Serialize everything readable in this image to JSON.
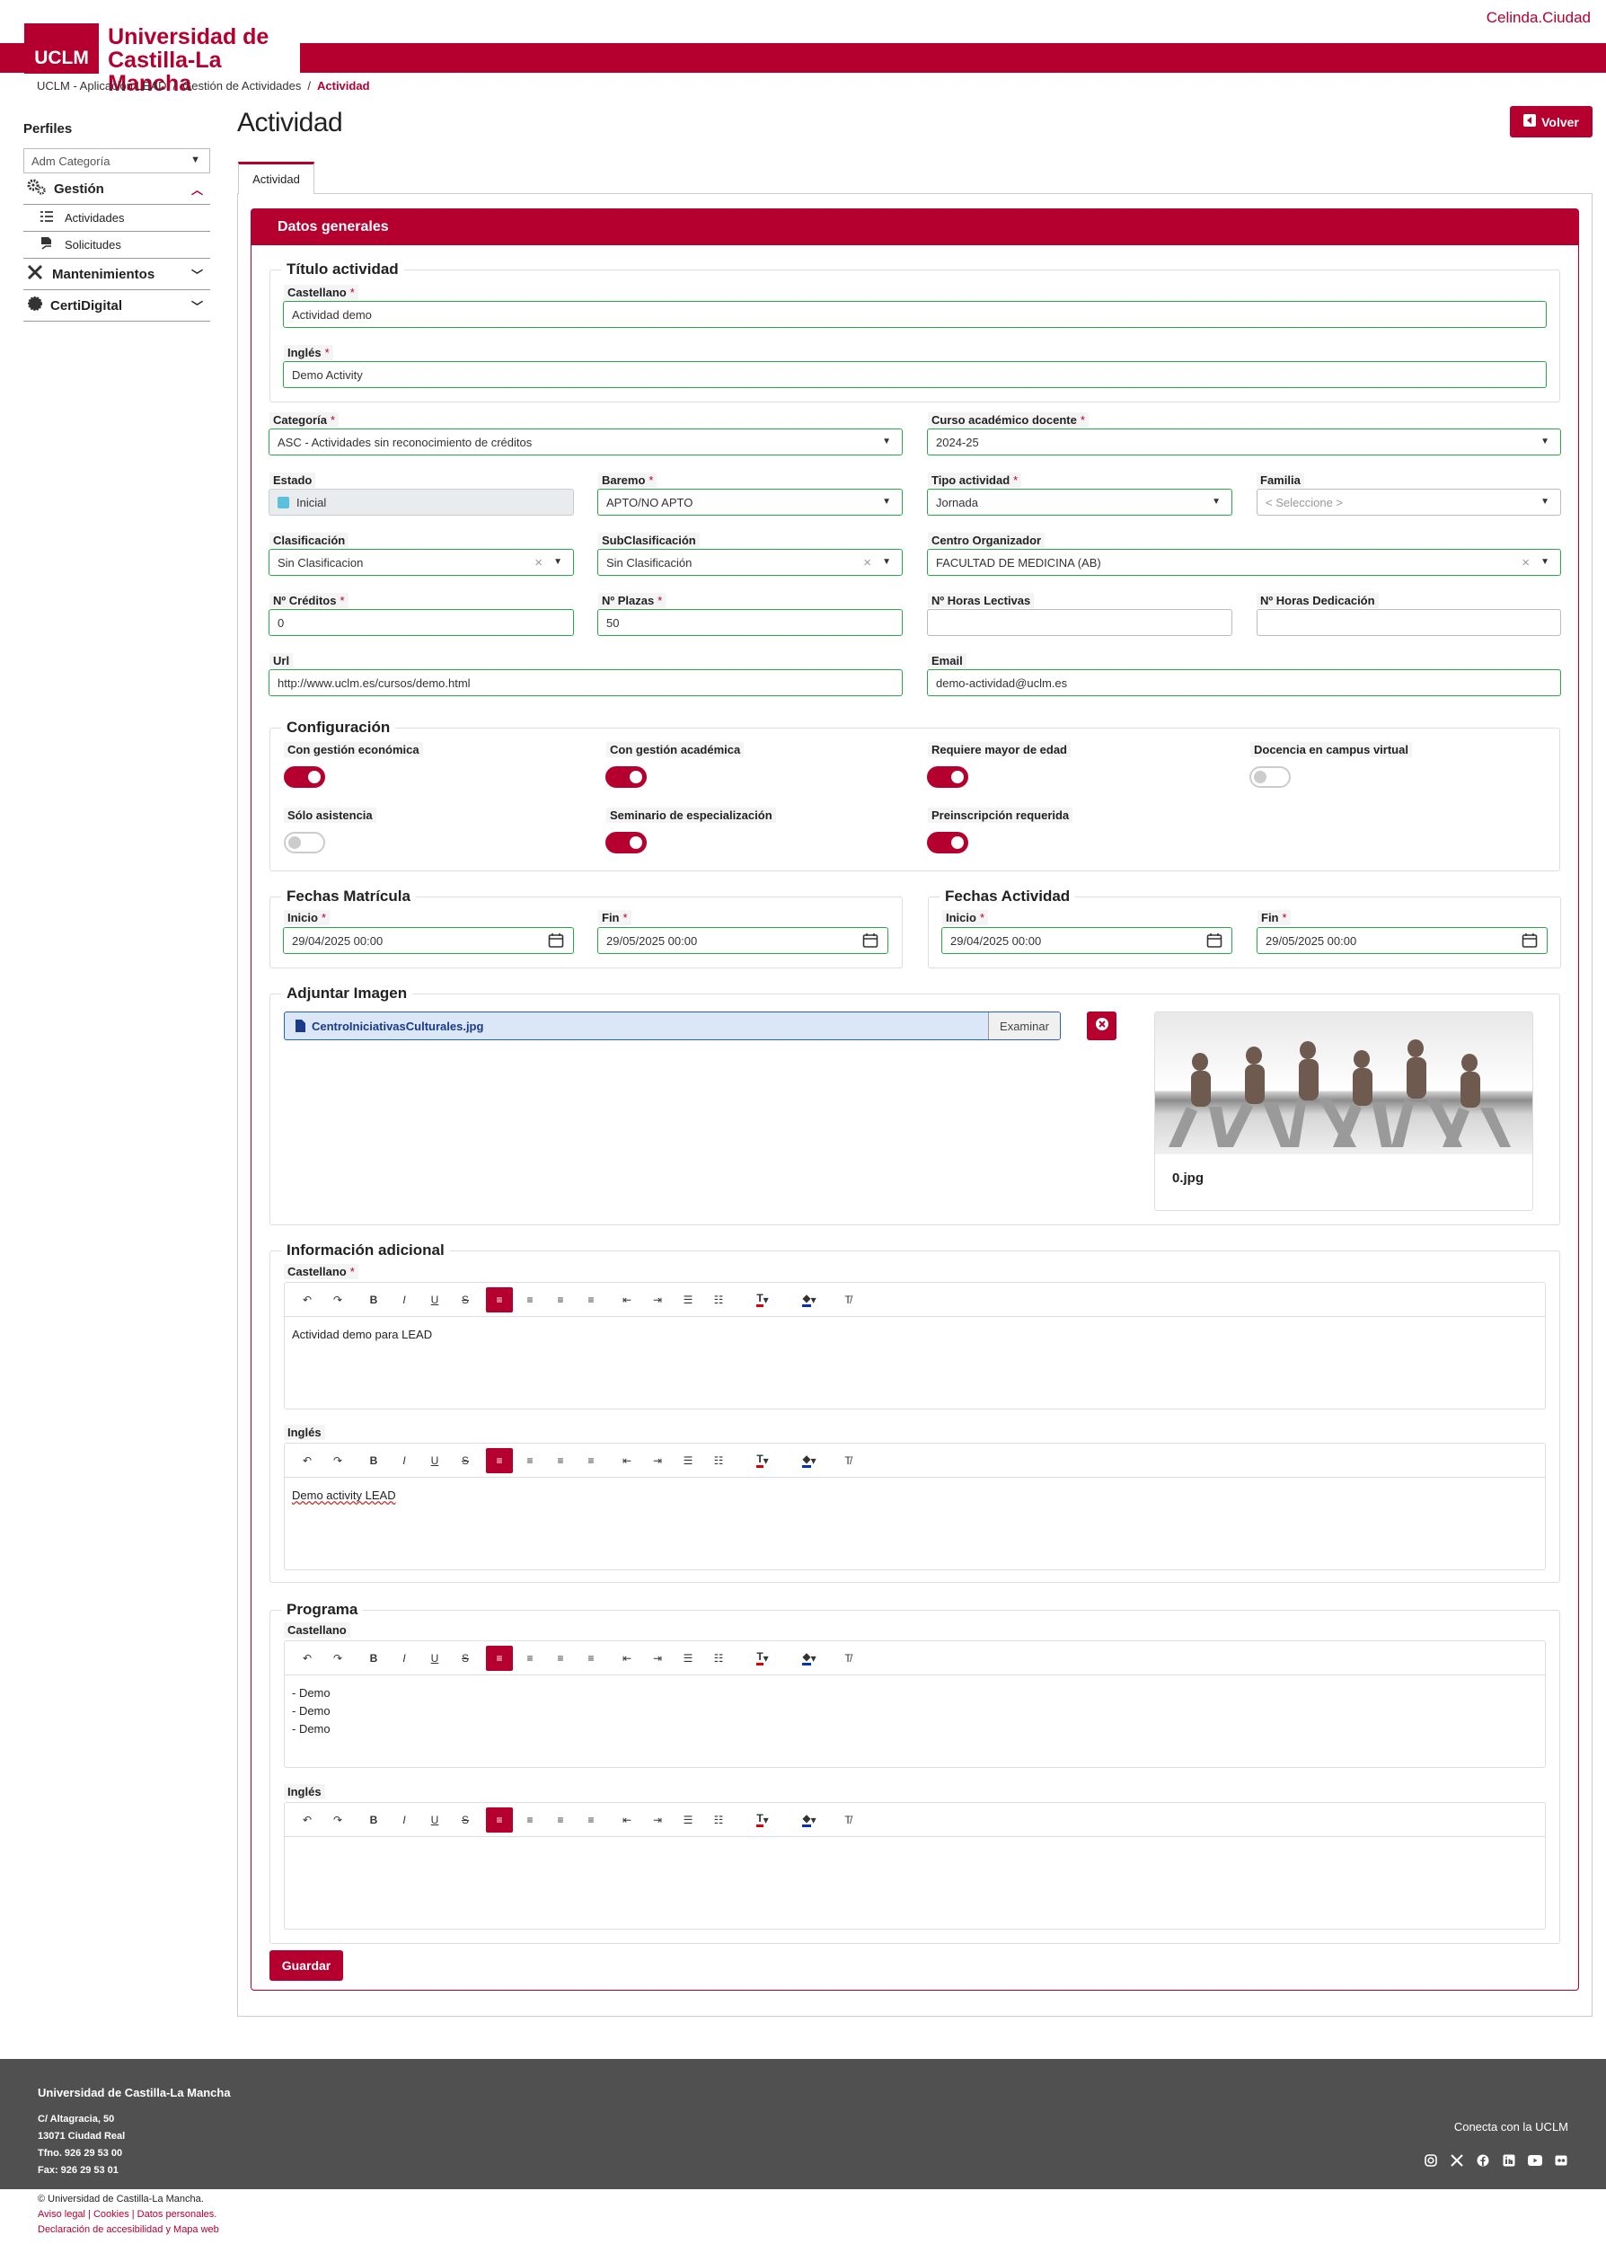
{
  "header": {
    "logo_mark": "UCLM",
    "logo_line1": "Universidad de",
    "logo_line2": "Castilla-La Mancha",
    "user": "Celinda.Ciudad"
  },
  "breadcrumb": [
    "UCLM - Aplicación LEAD",
    "Gestión de Actividades",
    "Actividad"
  ],
  "sidebar": {
    "title": "Perfiles",
    "profile": "Adm Categoría",
    "items": [
      {
        "label": "Gestión",
        "sub": [
          "Actividades",
          "Solicitudes"
        ]
      },
      {
        "label": "Mantenimientos"
      },
      {
        "label": "CertiDigital"
      }
    ]
  },
  "page": {
    "title": "Actividad",
    "back": "Volver",
    "tab": "Actividad",
    "card_title": "Datos generales",
    "save": "Guardar"
  },
  "titulo": {
    "legend": "Título actividad",
    "castellano_label": "Castellano",
    "castellano": "Actividad demo",
    "ingles_label": "Inglés",
    "ingles": "Demo Activity"
  },
  "fields": {
    "categoria_label": "Categoría",
    "categoria": "ASC - Actividades sin reconocimiento de créditos",
    "curso_label": "Curso académico docente",
    "curso": "2024-25",
    "estado_label": "Estado",
    "estado": "Inicial",
    "baremo_label": "Baremo",
    "baremo": "APTO/NO APTO",
    "tipo_label": "Tipo actividad",
    "tipo": "Jornada",
    "familia_label": "Familia",
    "familia_placeholder": "< Seleccione >",
    "clasificacion_label": "Clasificación",
    "clasificacion": "Sin Clasificacion",
    "subclasificacion_label": "SubClasificación",
    "subclasificacion": "Sin Clasificación",
    "centro_label": "Centro Organizador",
    "centro": "FACULTAD DE MEDICINA (AB)",
    "creditos_label": "Nº Créditos",
    "creditos": "0",
    "plazas_label": "Nº Plazas",
    "plazas": "50",
    "horas_lectivas_label": "Nº Horas Lectivas",
    "horas_lectivas": "",
    "horas_dedicacion_label": "Nº Horas Dedicación",
    "horas_dedicacion": "",
    "url_label": "Url",
    "url": "http://www.uclm.es/cursos/demo.html",
    "email_label": "Email",
    "email": "demo-actividad@uclm.es"
  },
  "config": {
    "legend": "Configuración",
    "toggles": [
      {
        "label": "Con gestión económica",
        "on": true
      },
      {
        "label": "Con gestión académica",
        "on": true
      },
      {
        "label": "Requiere mayor de edad",
        "on": true
      },
      {
        "label": "Docencia en campus virtual",
        "on": false
      },
      {
        "label": "Sólo asistencia",
        "on": false
      },
      {
        "label": "Seminario de especialización",
        "on": true
      },
      {
        "label": "Preinscripción requerida",
        "on": true
      }
    ]
  },
  "matricula": {
    "legend": "Fechas Matrícula",
    "inicio_label": "Inicio",
    "inicio": "29/04/2025 00:00",
    "fin_label": "Fin",
    "fin": "29/05/2025 00:00"
  },
  "actividad_fechas": {
    "legend": "Fechas Actividad",
    "inicio_label": "Inicio",
    "inicio": "29/04/2025 00:00",
    "fin_label": "Fin",
    "fin": "29/05/2025 00:00"
  },
  "imagen": {
    "legend": "Adjuntar Imagen",
    "file": "CentroIniciativasCulturales.jpg",
    "browse": "Examinar",
    "preview_name": "0.jpg"
  },
  "info": {
    "legend": "Información adicional",
    "castellano_label": "Castellano",
    "castellano": "Actividad demo para LEAD",
    "ingles_label": "Inglés",
    "ingles": "Demo activity LEAD"
  },
  "programa": {
    "legend": "Programa",
    "castellano_label": "Castellano",
    "castellano_lines": [
      "- Demo",
      "- Demo",
      "- Demo"
    ],
    "ingles_label": "Inglés"
  },
  "footer": {
    "title": "Universidad de Castilla-La Mancha",
    "address": [
      "C/ Altagracia, 50",
      "13071 Ciudad Real",
      "Tfno. 926 29 53 00",
      "Fax: 926 29 53 01"
    ],
    "connect": "Conecta con la UCLM",
    "copyright": "© Universidad de Castilla-La Mancha.",
    "links1": "Aviso legal | Cookies | Datos personales.",
    "links2": "Declaración de accesibilidad y Mapa web"
  },
  "colors": {
    "brand": "#b5002f",
    "valid": "#28a745",
    "footer": "#505050"
  }
}
